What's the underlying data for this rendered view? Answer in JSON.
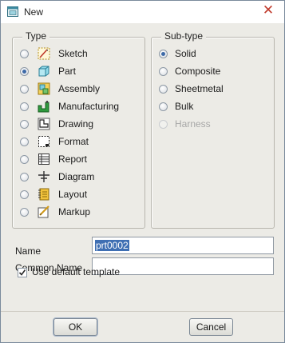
{
  "window": {
    "title": "New",
    "close_glyph": "✕"
  },
  "type_group": {
    "legend": "Type",
    "items": [
      {
        "label": "Sketch",
        "icon": "sketch-icon",
        "checked": false
      },
      {
        "label": "Part",
        "icon": "part-icon",
        "checked": true
      },
      {
        "label": "Assembly",
        "icon": "assembly-icon",
        "checked": false
      },
      {
        "label": "Manufacturing",
        "icon": "manufacturing-icon",
        "checked": false
      },
      {
        "label": "Drawing",
        "icon": "drawing-icon",
        "checked": false
      },
      {
        "label": "Format",
        "icon": "format-icon",
        "checked": false
      },
      {
        "label": "Report",
        "icon": "report-icon",
        "checked": false
      },
      {
        "label": "Diagram",
        "icon": "diagram-icon",
        "checked": false
      },
      {
        "label": "Layout",
        "icon": "layout-icon",
        "checked": false
      },
      {
        "label": "Markup",
        "icon": "markup-icon",
        "checked": false
      }
    ]
  },
  "subtype_group": {
    "legend": "Sub-type",
    "items": [
      {
        "label": "Solid",
        "checked": true,
        "disabled": false
      },
      {
        "label": "Composite",
        "checked": false,
        "disabled": false
      },
      {
        "label": "Sheetmetal",
        "checked": false,
        "disabled": false
      },
      {
        "label": "Bulk",
        "checked": false,
        "disabled": false
      },
      {
        "label": "Harness",
        "checked": false,
        "disabled": true
      }
    ]
  },
  "name_field": {
    "label": "Name",
    "value": "prt0002"
  },
  "common_name_field": {
    "label": "Common Name",
    "value": ""
  },
  "default_template": {
    "label": "Use default template",
    "checked": true
  },
  "buttons": {
    "ok": "OK",
    "cancel": "Cancel"
  },
  "colors": {
    "selection": "#3f6fb3",
    "close": "#c0392b",
    "radio_dot": "#3e6aa7"
  }
}
